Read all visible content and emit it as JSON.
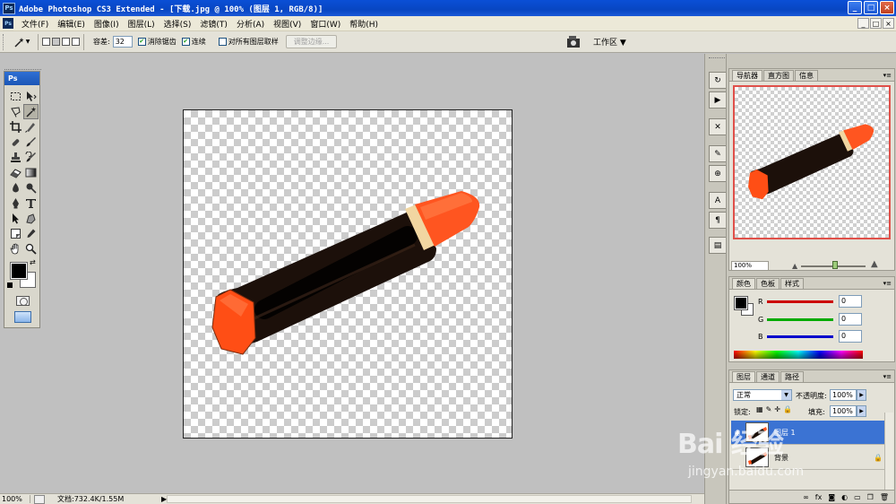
{
  "title_bar": {
    "logo_text": "Ps",
    "title": "Adobe Photoshop CS3 Extended - [下载.jpg @ 100% (图层 1, RGB/8)]",
    "buttons": {
      "minimize": "_",
      "maximize": "□",
      "close": "×"
    }
  },
  "menu_bar": {
    "app_icon": "Ps",
    "items": [
      "文件(F)",
      "编辑(E)",
      "图像(I)",
      "图层(L)",
      "选择(S)",
      "滤镜(T)",
      "分析(A)",
      "视图(V)",
      "窗口(W)",
      "帮助(H)"
    ],
    "doc_buttons": [
      "_",
      "□",
      "×"
    ]
  },
  "options_bar": {
    "tolerance_label": "容差:",
    "tolerance_value": "32",
    "anti_alias_label": "消除锯齿",
    "anti_alias_checked": true,
    "contiguous_label": "连续",
    "contiguous_checked": true,
    "sample_all_label": "对所有图层取样",
    "sample_all_checked": false,
    "refine_edge_label": "调整边缘...",
    "workspace_label": "工作区 ▼"
  },
  "toolbox": {
    "header": "Ps",
    "tools": [
      "marquee-tool",
      "move-tool",
      "lasso-tool",
      "magic-wand-tool",
      "crop-tool",
      "slice-tool",
      "healing-brush-tool",
      "brush-tool",
      "clone-stamp-tool",
      "history-brush-tool",
      "eraser-tool",
      "gradient-tool",
      "blur-tool",
      "dodge-tool",
      "pen-tool",
      "type-tool",
      "path-selection-tool",
      "shape-tool",
      "notes-tool",
      "eyedropper-tool",
      "hand-tool",
      "zoom-tool"
    ],
    "active_tool": "magic-wand-tool",
    "foreground_color": "#000000",
    "background_color": "#ffffff"
  },
  "status_bar": {
    "zoom": "100%",
    "doc_info": "文档:732.4K/1.55M",
    "arrow": "▶"
  },
  "navigator_panel": {
    "tabs": [
      "导航器",
      "直方图",
      "信息"
    ],
    "active_tab": "导航器",
    "zoom": "100%",
    "view_box_color": "#e0504a"
  },
  "color_panel": {
    "tabs": [
      "颜色",
      "色板",
      "样式"
    ],
    "active_tab": "颜色",
    "channels": [
      {
        "label": "R",
        "value": "0",
        "color": "#cc0000"
      },
      {
        "label": "G",
        "value": "0",
        "color": "#00aa00"
      },
      {
        "label": "B",
        "value": "0",
        "color": "#0000cc"
      }
    ]
  },
  "layers_panel": {
    "tabs": [
      "图层",
      "通道",
      "路径"
    ],
    "active_tab": "图层",
    "blend_mode": "正常",
    "opacity_label": "不透明度:",
    "opacity_value": "100%",
    "lock_label": "锁定:",
    "fill_label": "填充:",
    "fill_value": "100%",
    "layers": [
      {
        "name": "图层 1",
        "selected": true,
        "visible": true,
        "locked": false
      },
      {
        "name": "背景",
        "selected": false,
        "visible": false,
        "locked": true
      }
    ]
  },
  "document": {
    "content": "orange-and-black crayon on transparent background",
    "crayon_body_color": "#1a0e08",
    "crayon_cap_color": "#ff5a1a",
    "crayon_band_color": "#f3d9a6"
  },
  "watermark": {
    "main": "Bai  经验",
    "sub": "jingyan.baidu.com"
  }
}
